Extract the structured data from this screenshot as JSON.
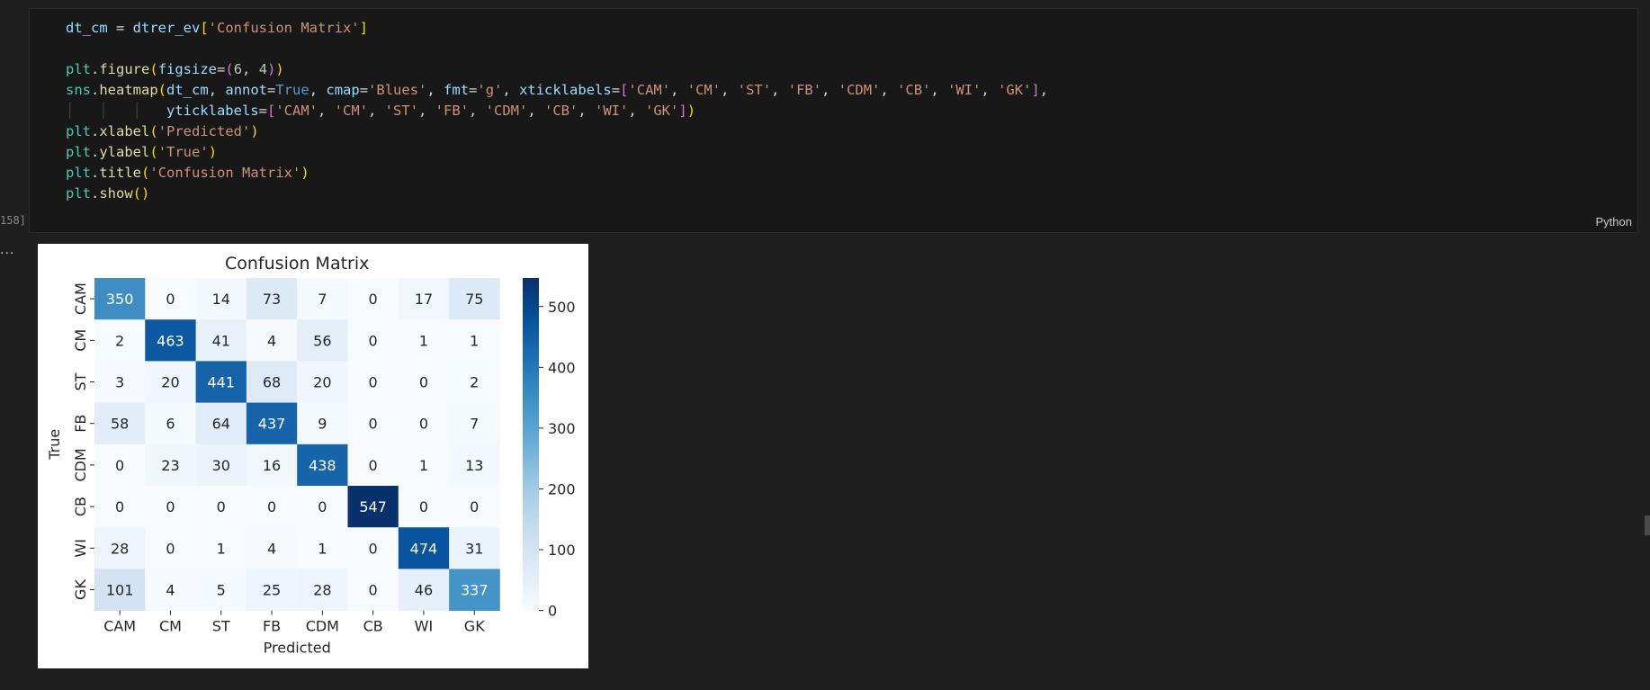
{
  "cell": {
    "execution_count": "158]",
    "language": "Python",
    "code_lines": [
      [
        [
          "tk-var",
          "dt_cm"
        ],
        [
          "tk-p",
          " = "
        ],
        [
          "tk-var",
          "dtrer_ev"
        ],
        [
          "tk-br1",
          "["
        ],
        [
          "tk-str",
          "'Confusion Matrix'"
        ],
        [
          "tk-br1",
          "]"
        ]
      ],
      [],
      [
        [
          "tk-mod",
          "plt"
        ],
        [
          "tk-p",
          "."
        ],
        [
          "tk-fn",
          "figure"
        ],
        [
          "tk-br1",
          "("
        ],
        [
          "tk-var",
          "figsize"
        ],
        [
          "tk-p",
          "="
        ],
        [
          "tk-br2",
          "("
        ],
        [
          "tk-num",
          "6"
        ],
        [
          "tk-p",
          ", "
        ],
        [
          "tk-num",
          "4"
        ],
        [
          "tk-br2",
          ")"
        ],
        [
          "tk-br1",
          ")"
        ]
      ],
      [
        [
          "tk-mod",
          "sns"
        ],
        [
          "tk-p",
          "."
        ],
        [
          "tk-fn",
          "heatmap"
        ],
        [
          "tk-br1",
          "("
        ],
        [
          "tk-var",
          "dt_cm"
        ],
        [
          "tk-p",
          ", "
        ],
        [
          "tk-var",
          "annot"
        ],
        [
          "tk-p",
          "="
        ],
        [
          "tk-kw",
          "True"
        ],
        [
          "tk-p",
          ", "
        ],
        [
          "tk-var",
          "cmap"
        ],
        [
          "tk-p",
          "="
        ],
        [
          "tk-str",
          "'Blues'"
        ],
        [
          "tk-p",
          ", "
        ],
        [
          "tk-var",
          "fmt"
        ],
        [
          "tk-p",
          "="
        ],
        [
          "tk-str",
          "'g'"
        ],
        [
          "tk-p",
          ", "
        ],
        [
          "tk-var",
          "xticklabels"
        ],
        [
          "tk-p",
          "="
        ],
        [
          "tk-br2",
          "["
        ],
        [
          "tk-str",
          "'CAM'"
        ],
        [
          "tk-p",
          ", "
        ],
        [
          "tk-str",
          "'CM'"
        ],
        [
          "tk-p",
          ", "
        ],
        [
          "tk-str",
          "'ST'"
        ],
        [
          "tk-p",
          ", "
        ],
        [
          "tk-str",
          "'FB'"
        ],
        [
          "tk-p",
          ", "
        ],
        [
          "tk-str",
          "'CDM'"
        ],
        [
          "tk-p",
          ", "
        ],
        [
          "tk-str",
          "'CB'"
        ],
        [
          "tk-p",
          ", "
        ],
        [
          "tk-str",
          "'WI'"
        ],
        [
          "tk-p",
          ", "
        ],
        [
          "tk-str",
          "'GK'"
        ],
        [
          "tk-br2",
          "]"
        ],
        [
          "tk-p",
          ","
        ]
      ],
      [
        [
          "indent-guide",
          "│   │   │   "
        ],
        [
          "tk-var",
          "yticklabels"
        ],
        [
          "tk-p",
          "="
        ],
        [
          "tk-br2",
          "["
        ],
        [
          "tk-str",
          "'CAM'"
        ],
        [
          "tk-p",
          ", "
        ],
        [
          "tk-str",
          "'CM'"
        ],
        [
          "tk-p",
          ", "
        ],
        [
          "tk-str",
          "'ST'"
        ],
        [
          "tk-p",
          ", "
        ],
        [
          "tk-str",
          "'FB'"
        ],
        [
          "tk-p",
          ", "
        ],
        [
          "tk-str",
          "'CDM'"
        ],
        [
          "tk-p",
          ", "
        ],
        [
          "tk-str",
          "'CB'"
        ],
        [
          "tk-p",
          ", "
        ],
        [
          "tk-str",
          "'WI'"
        ],
        [
          "tk-p",
          ", "
        ],
        [
          "tk-str",
          "'GK'"
        ],
        [
          "tk-br2",
          "]"
        ],
        [
          "tk-br1",
          ")"
        ]
      ],
      [
        [
          "tk-mod",
          "plt"
        ],
        [
          "tk-p",
          "."
        ],
        [
          "tk-fn",
          "xlabel"
        ],
        [
          "tk-br1",
          "("
        ],
        [
          "tk-str",
          "'Predicted'"
        ],
        [
          "tk-br1",
          ")"
        ]
      ],
      [
        [
          "tk-mod",
          "plt"
        ],
        [
          "tk-p",
          "."
        ],
        [
          "tk-fn",
          "ylabel"
        ],
        [
          "tk-br1",
          "("
        ],
        [
          "tk-str",
          "'True'"
        ],
        [
          "tk-br1",
          ")"
        ]
      ],
      [
        [
          "tk-mod",
          "plt"
        ],
        [
          "tk-p",
          "."
        ],
        [
          "tk-fn",
          "title"
        ],
        [
          "tk-br1",
          "("
        ],
        [
          "tk-str",
          "'Confusion Matrix'"
        ],
        [
          "tk-br1",
          ")"
        ]
      ],
      [
        [
          "tk-mod",
          "plt"
        ],
        [
          "tk-p",
          "."
        ],
        [
          "tk-fn",
          "show"
        ],
        [
          "tk-br1",
          "()"
        ]
      ]
    ]
  },
  "output": {
    "ellipsis": "..."
  },
  "chart_data": {
    "type": "heatmap",
    "title": "Confusion Matrix",
    "xlabel": "Predicted",
    "ylabel": "True",
    "x_categories": [
      "CAM",
      "CM",
      "ST",
      "FB",
      "CDM",
      "CB",
      "WI",
      "GK"
    ],
    "y_categories": [
      "CAM",
      "CM",
      "ST",
      "FB",
      "CDM",
      "CB",
      "WI",
      "GK"
    ],
    "values": [
      [
        350,
        0,
        14,
        73,
        7,
        0,
        17,
        75
      ],
      [
        2,
        463,
        41,
        4,
        56,
        0,
        1,
        1
      ],
      [
        3,
        20,
        441,
        68,
        20,
        0,
        0,
        2
      ],
      [
        58,
        6,
        64,
        437,
        9,
        0,
        0,
        7
      ],
      [
        0,
        23,
        30,
        16,
        438,
        0,
        1,
        13
      ],
      [
        0,
        0,
        0,
        0,
        0,
        547,
        0,
        0
      ],
      [
        28,
        0,
        1,
        4,
        1,
        0,
        474,
        31
      ],
      [
        101,
        4,
        5,
        25,
        28,
        0,
        46,
        337
      ]
    ],
    "colormap": "Blues",
    "vmin": 0,
    "vmax": 547,
    "colorbar_ticks": [
      0,
      100,
      200,
      300,
      400,
      500
    ]
  }
}
